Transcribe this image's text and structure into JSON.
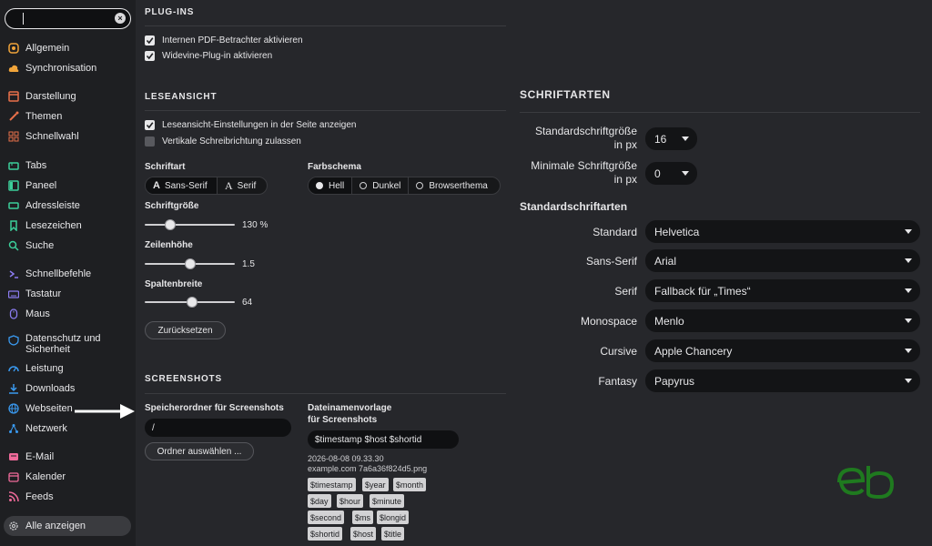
{
  "sidebar": {
    "search": {
      "value": ""
    },
    "items": [
      {
        "label": "Allgemein",
        "icon": "settings-square-icon",
        "color": "#f0a43a"
      },
      {
        "label": "Synchronisation",
        "icon": "cloud-icon",
        "color": "#f0a43a"
      },
      {
        "label": "Darstellung",
        "icon": "appearance-icon",
        "color": "#e8704a"
      },
      {
        "label": "Themen",
        "icon": "brush-icon",
        "color": "#e8704a"
      },
      {
        "label": "Schnellwahl",
        "icon": "speed-dial-icon",
        "color": "#e8704a"
      },
      {
        "label": "Tabs",
        "icon": "tabs-icon",
        "color": "#3ccf9a"
      },
      {
        "label": "Paneel",
        "icon": "panel-icon",
        "color": "#3ccf9a"
      },
      {
        "label": "Adressleiste",
        "icon": "address-bar-icon",
        "color": "#3ccf9a"
      },
      {
        "label": "Lesezeichen",
        "icon": "bookmark-icon",
        "color": "#3ccf9a"
      },
      {
        "label": "Suche",
        "icon": "search-icon",
        "color": "#3ccf9a"
      },
      {
        "label": "Schnellbefehle",
        "icon": "quick-commands-icon",
        "color": "#8b7cf0"
      },
      {
        "label": "Tastatur",
        "icon": "keyboard-icon",
        "color": "#8b7cf0"
      },
      {
        "label": "Maus",
        "icon": "mouse-icon",
        "color": "#8b7cf0"
      },
      {
        "label": "Datenschutz und Sicherheit",
        "icon": "shield-icon",
        "color": "#3a9af0"
      },
      {
        "label": "Leistung",
        "icon": "gauge-icon",
        "color": "#3a9af0"
      },
      {
        "label": "Downloads",
        "icon": "download-icon",
        "color": "#3a9af0"
      },
      {
        "label": "Webseiten",
        "icon": "globe-icon",
        "color": "#3a9af0"
      },
      {
        "label": "Netzwerk",
        "icon": "network-icon",
        "color": "#3a9af0"
      },
      {
        "label": "E-Mail",
        "icon": "mail-icon",
        "color": "#f06a9a"
      },
      {
        "label": "Kalender",
        "icon": "calendar-icon",
        "color": "#f06a9a"
      },
      {
        "label": "Feeds",
        "icon": "feed-icon",
        "color": "#f06a9a"
      }
    ],
    "all_label": "Alle anzeigen"
  },
  "plugins": {
    "title": "PLUG-INS",
    "pdf_label": "Internen PDF-Betrachter aktivieren",
    "pdf_checked": true,
    "widevine_label": "Widevine-Plug-in aktivieren",
    "widevine_checked": true
  },
  "reader": {
    "title": "LESEANSICHT",
    "settings_label": "Leseansicht-Einstellungen in der Seite anzeigen",
    "settings_checked": true,
    "vertical_label": "Vertikale Schreibrichtung zulassen",
    "vertical_checked": false,
    "font_title": "Schriftart",
    "font_options": [
      "Sans-Serif",
      "Serif"
    ],
    "font_glyph": "A",
    "scheme_title": "Farbschema",
    "scheme_options": [
      "Hell",
      "Dunkel",
      "Browserthema"
    ],
    "scheme_selected": "Hell",
    "font_size_title": "Schriftgröße",
    "font_size_value": "130 %",
    "font_size_fraction": 0.25,
    "line_height_title": "Zeilenhöhe",
    "line_height_value": "1.5",
    "line_height_fraction": 0.5,
    "column_width_title": "Spaltenbreite",
    "column_width_value": "64",
    "column_width_fraction": 0.53,
    "reset_label": "Zurücksetzen"
  },
  "screenshots": {
    "title": "SCREENSHOTS",
    "folder_title": "Speicherordner für Screenshots",
    "folder_value": "/",
    "choose_label": "Ordner auswählen ...",
    "template_title_line1": "Dateinamenvorlage",
    "template_title_line2": "für Screenshots",
    "template_value": "$timestamp $host $shortid",
    "preview_line1": "2026-08-08 09.33.30",
    "preview_line2": "example.com 7a6a36f824d5.png",
    "tokens": [
      [
        "$timestamp",
        "$year",
        "$month"
      ],
      [
        "$day",
        "$hour",
        "$minute"
      ],
      [
        "$second",
        "$ms",
        "$longid"
      ],
      [
        "$shortid",
        "$host",
        "$title"
      ]
    ]
  },
  "fonts": {
    "title": "SCHRIFTARTEN",
    "default_size_label_line1": "Standardschriftgröße",
    "default_size_label_line2": "in px",
    "default_size_value": "16",
    "min_size_label_line1": "Minimale Schriftgröße",
    "min_size_label_line2": "in px",
    "min_size_value": "0",
    "defaults_title": "Standardschriftarten",
    "rows": [
      {
        "label": "Standard",
        "value": "Helvetica"
      },
      {
        "label": "Sans-Serif",
        "value": "Arial"
      },
      {
        "label": "Serif",
        "value": "Fallback für „Times“"
      },
      {
        "label": "Monospace",
        "value": "Menlo"
      },
      {
        "label": "Cursive",
        "value": "Apple Chancery"
      },
      {
        "label": "Fantasy",
        "value": "Papyrus"
      }
    ]
  },
  "colors": {
    "accent_logo": "#1f7a1f",
    "arrow": "#ffffff"
  }
}
